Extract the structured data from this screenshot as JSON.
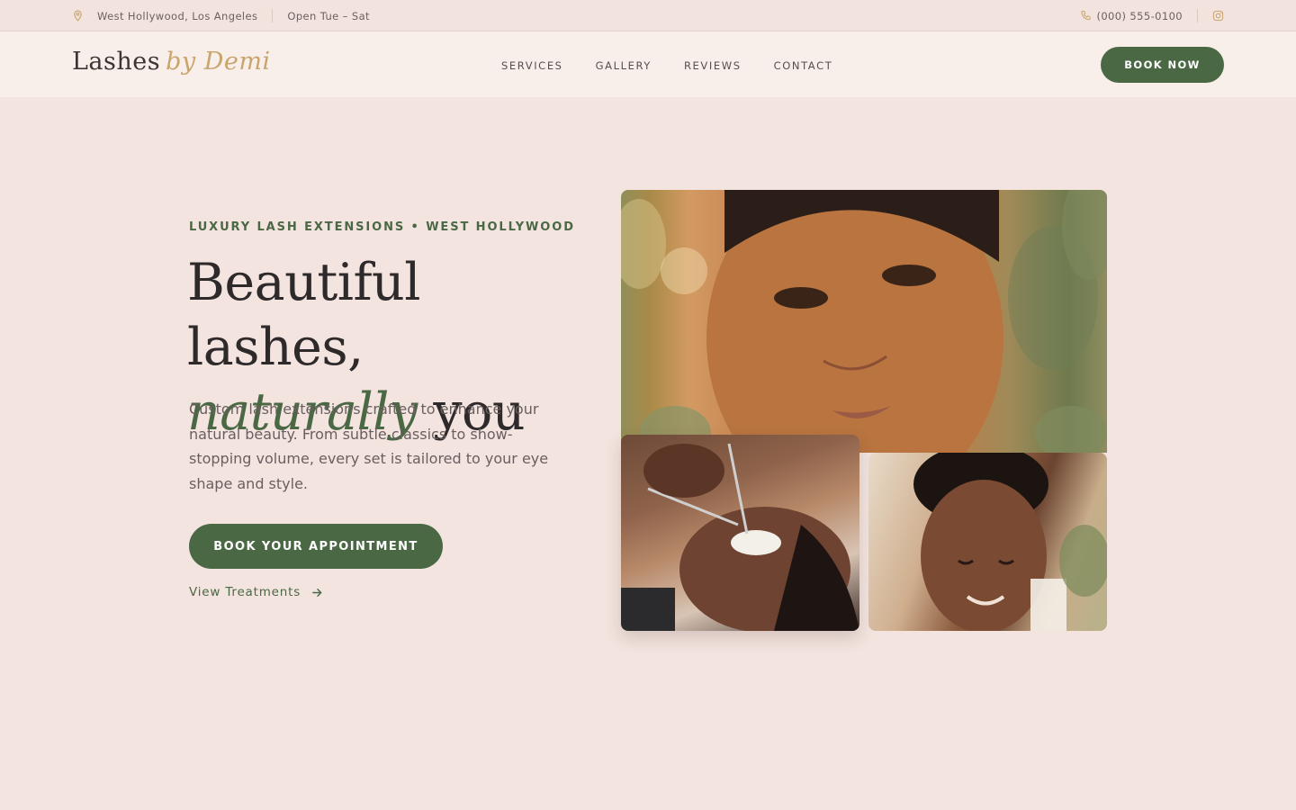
{
  "topbar": {
    "location": "West Hollywood, Los Angeles",
    "hours": "Open Tue – Sat",
    "phone": "(000) 555-0100",
    "icons": [
      "map-pin-icon",
      "phone-icon",
      "instagram-icon"
    ]
  },
  "nav": {
    "logo_main": "Lashes",
    "logo_accent": "by Demi",
    "menu": [
      "SERVICES",
      "GALLERY",
      "REVIEWS",
      "CONTACT"
    ],
    "cta": "BOOK NOW"
  },
  "hero": {
    "eyebrow": "LUXURY LASH EXTENSIONS • WEST HOLLYWOOD",
    "headline_line1": "Beautiful lashes,",
    "headline_em": "naturally",
    "headline_rest": " you",
    "description": "Custom lash extensions crafted to enhance your natural beauty. From subtle classics to show-stopping volume, every set is tailored to your eye shape and style.",
    "primary_cta": "BOOK YOUR APPOINTMENT",
    "secondary_cta": "View Treatments"
  },
  "colors": {
    "background": "#f3e4df",
    "nav_background": "#f8eeea",
    "accent_green": "#4a6844",
    "accent_gold": "#c9a46c"
  }
}
